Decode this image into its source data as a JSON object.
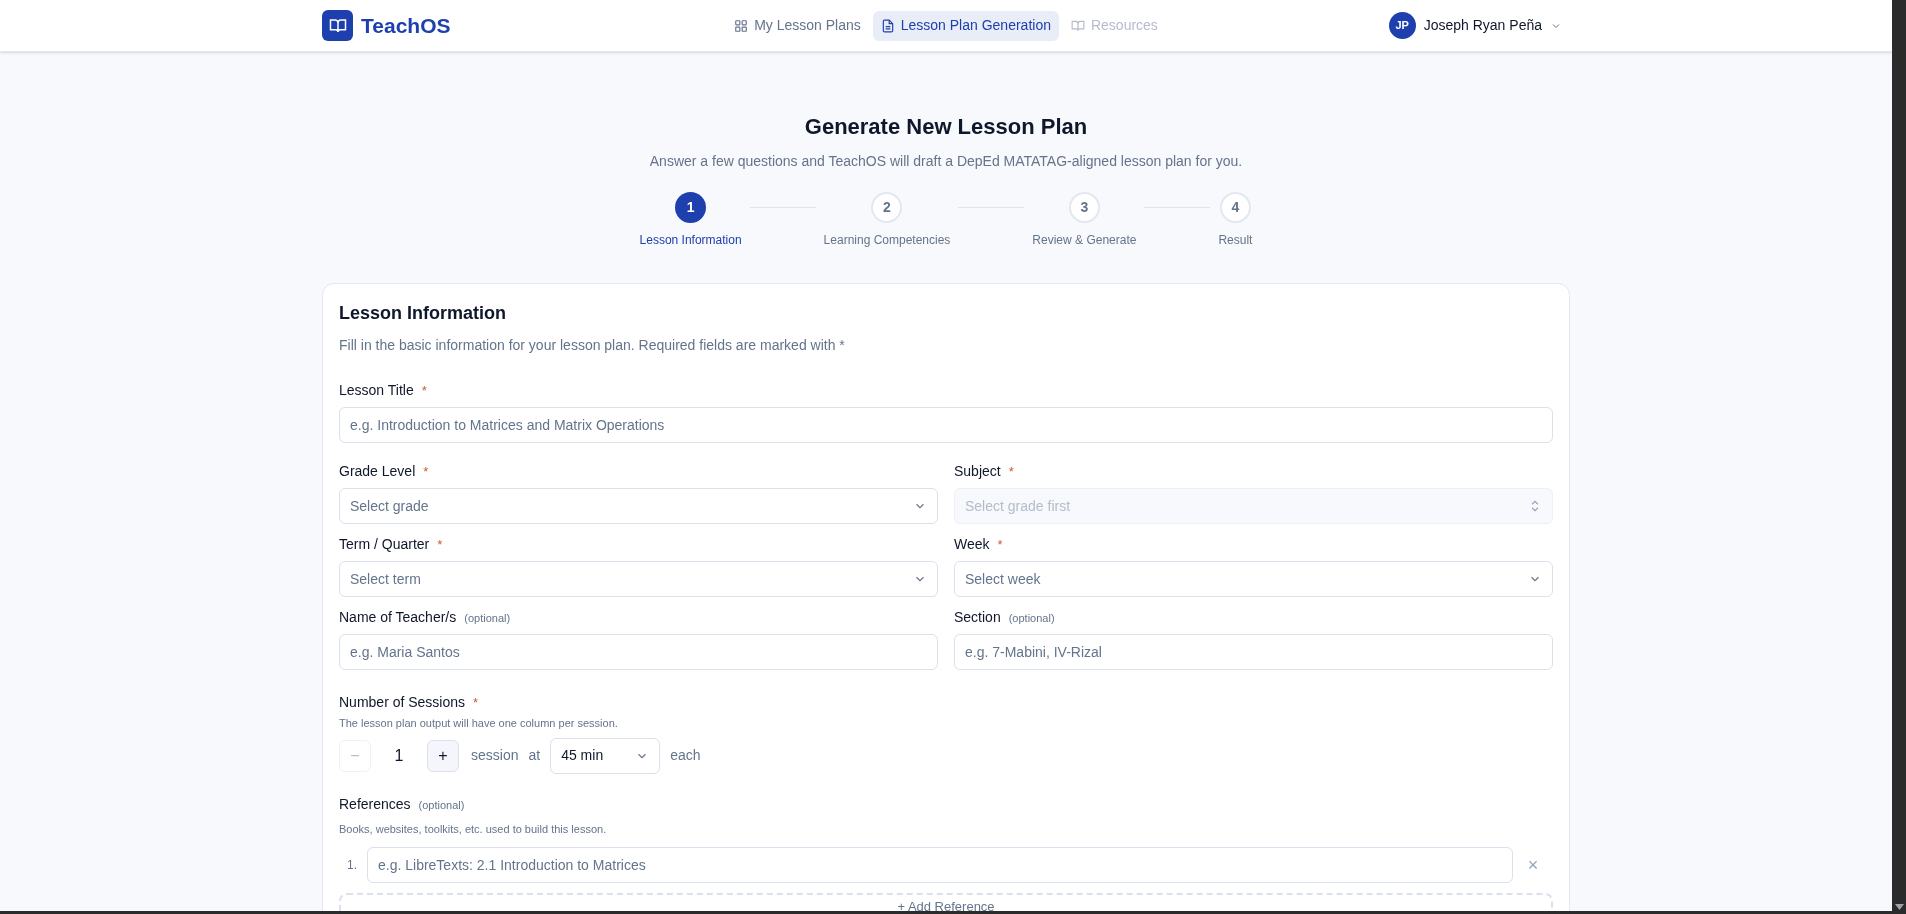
{
  "header": {
    "brand": "TeachOS",
    "nav": [
      {
        "label": "My Lesson Plans",
        "kind": "grid",
        "selected": false,
        "disabled": false
      },
      {
        "label": "Lesson Plan Generation",
        "kind": "document",
        "selected": true,
        "disabled": false
      },
      {
        "label": "Resources",
        "kind": "book",
        "selected": false,
        "disabled": true
      }
    ],
    "user": {
      "initials": "JP",
      "name": "Joseph Ryan Peña"
    }
  },
  "page": {
    "title": "Generate New Lesson Plan",
    "subtitle": "Answer a few questions and TeachOS will draft a DepEd MATATAG-aligned lesson plan for you."
  },
  "steps": [
    {
      "number": "1",
      "label": "Lesson Information",
      "selected": true
    },
    {
      "number": "2",
      "label": "Learning Competencies",
      "selected": false
    },
    {
      "number": "3",
      "label": "Review & Generate",
      "selected": false
    },
    {
      "number": "4",
      "label": "Result",
      "selected": false
    }
  ],
  "card": {
    "title": "Lesson Information",
    "description": "Fill in the basic information for your lesson plan. Required fields are marked with *",
    "fields": [
      {
        "kind": "text",
        "label": "Lesson Title",
        "required": "*",
        "placeholder": "e.g. Introduction to Matrices and Matrix Operations"
      },
      {
        "kind": "select",
        "label": "Grade Level",
        "required": "*",
        "placeholder": "Select grade",
        "disabled": false
      },
      {
        "kind": "select",
        "label": "Subject",
        "required": "*",
        "placeholder": "Select grade first",
        "disabled": true
      },
      {
        "kind": "select",
        "label": "Term / Quarter",
        "required": "*",
        "placeholder": "Select term",
        "disabled": false
      },
      {
        "kind": "select",
        "label": "Week",
        "required": "*",
        "placeholder": "Select week",
        "disabled": false
      },
      {
        "kind": "text",
        "label": "Name of Teacher/s",
        "optional": "(optional)",
        "placeholder": "e.g. Maria Santos"
      },
      {
        "kind": "text",
        "label": "Section",
        "optional": "(optional)",
        "placeholder": "e.g. 7-Mabini, IV-Rizal"
      }
    ],
    "sessions": {
      "label": "Number of Sessions",
      "required": "*",
      "help": "The lesson plan output will have one column per session.",
      "minus": "−",
      "count": "1",
      "plus": "+",
      "unit": "session",
      "at": "at",
      "duration": "45 min",
      "each": "each",
      "minus_disabled": true
    },
    "references": {
      "label": "References",
      "optional": "(optional)",
      "help": "Books, websites, toolkits, etc. used to build this lesson.",
      "items": [
        {
          "number": "1.",
          "placeholder": "e.g. LibreTexts: 2.1 Introduction to Matrices",
          "remove": "×"
        }
      ],
      "add_button": "+ Add Reference"
    }
  }
}
